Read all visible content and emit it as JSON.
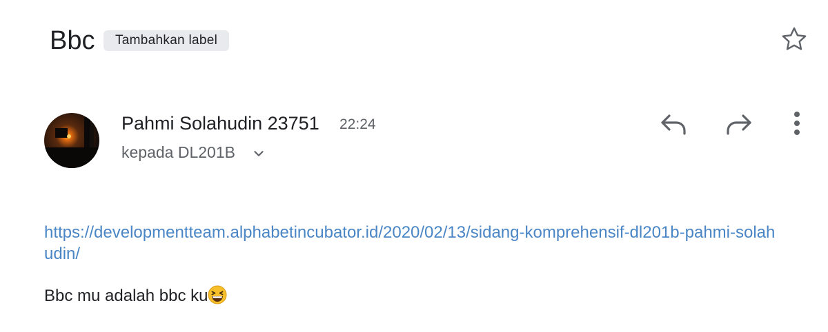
{
  "header": {
    "subject": "Bbc",
    "label_chip": "Tambahkan label",
    "star_icon": "star-outline-icon"
  },
  "message": {
    "sender_name": "Pahmi Solahudin 23751",
    "time": "22:24",
    "recipient": "kepada DL201B",
    "avatar": "sunset-photo",
    "actions": {
      "reply_icon": "reply-icon",
      "forward_icon": "forward-icon",
      "more_icon": "more-vert-icon"
    }
  },
  "body": {
    "link": "https://developmentteam.alphabetincubator.id/2020/02/13/sidang-komprehensif-dl201b-pahmi-solahudin/",
    "text": "Bbc mu adalah bbc ku",
    "emoji": "grinning-squinting-face"
  },
  "colors": {
    "link": "#4a86c6",
    "text": "#202124",
    "secondary": "#5f6368",
    "chip": "#e8eaed"
  }
}
